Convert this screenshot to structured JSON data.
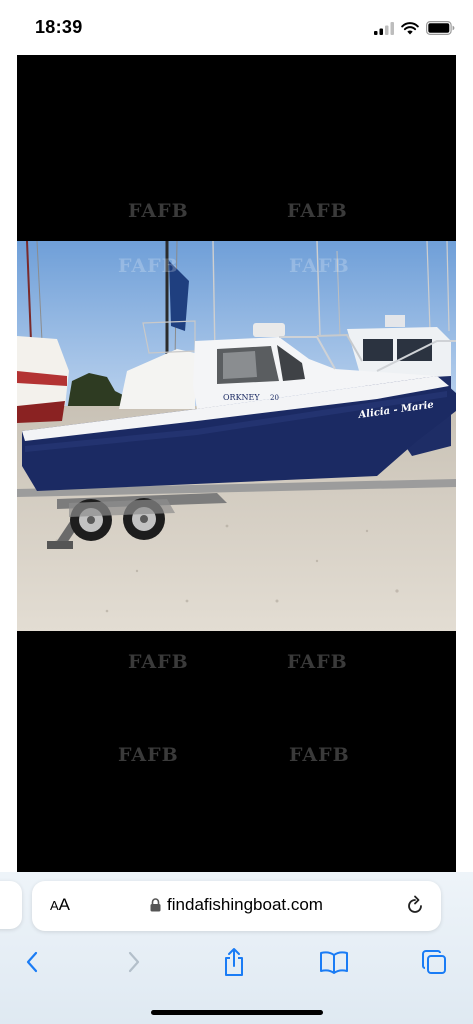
{
  "status_bar": {
    "time": "18:39",
    "icons": [
      "signal-icon",
      "wifi-icon",
      "battery-icon"
    ]
  },
  "viewer": {
    "watermarks": [
      "FAFB",
      "FAFB",
      "FAFB",
      "FAFB",
      "FAFB",
      "FAFB",
      "FAFB",
      "FAFB"
    ],
    "boat": {
      "model_text": "ORKNEY",
      "model_number": "20",
      "name_text": "Alicia - Marie"
    }
  },
  "browser": {
    "text_size_label_large": "A",
    "text_size_label_small": "A",
    "url": "findafishingboat.com",
    "icons": [
      "lock-icon",
      "reload-icon",
      "back-icon",
      "forward-icon",
      "share-icon",
      "bookmarks-icon",
      "tabs-icon"
    ]
  },
  "colors": {
    "accent": "#1a7cf5",
    "disabled": "#b3bfca",
    "hull": "#1b2a63"
  }
}
